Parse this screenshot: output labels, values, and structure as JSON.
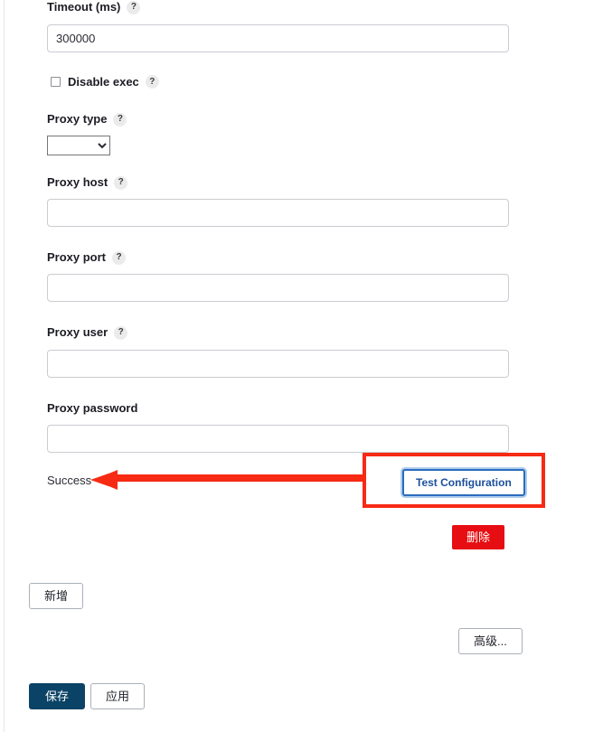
{
  "form": {
    "fields": [
      {
        "label": "Timeout (ms)",
        "help": "?",
        "value": "300000",
        "placeholder": ""
      },
      {
        "label": "Proxy host",
        "help": "?",
        "value": "",
        "placeholder": ""
      },
      {
        "label": "Proxy port",
        "help": "?",
        "value": "",
        "placeholder": ""
      },
      {
        "label": "Proxy user",
        "help": "?",
        "value": "",
        "placeholder": ""
      },
      {
        "label": "Proxy password",
        "help": "",
        "value": "",
        "placeholder": ""
      }
    ],
    "checkbox": {
      "label": "Disable exec",
      "help": "?",
      "checked": false
    },
    "proxy_type": {
      "label": "Proxy type",
      "help": "?",
      "selected": "",
      "options": [
        ""
      ]
    },
    "status": "Success"
  },
  "buttons": {
    "test_configuration": "Test Configuration",
    "delete": "删除",
    "add": "新增",
    "advanced": "高级...",
    "save": "保存",
    "apply": "应用"
  },
  "colors": {
    "annotation_red": "#f72a14",
    "delete_red": "#e60e12",
    "save_navy": "#0b4366",
    "test_border_blue": "#2c6bbd",
    "test_text_blue": "#1b4f9c",
    "focus_ring_blue": "#aecdee"
  }
}
